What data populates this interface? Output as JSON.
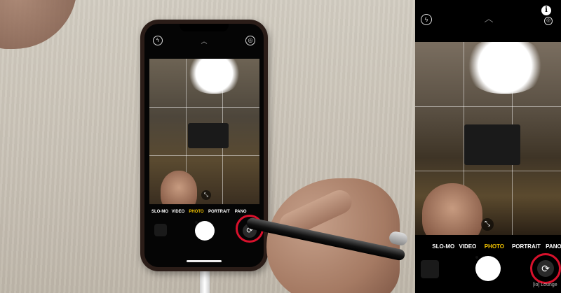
{
  "camera": {
    "modes": [
      "SLO-MO",
      "VIDEO",
      "PHOTO",
      "PORTRAIT",
      "PANO"
    ],
    "active_mode": "PHOTO",
    "accent_color": "#f3c400",
    "highlight_color": "#d8112c",
    "top_icons": {
      "flash": "flash-off-icon",
      "chevron": "chevron-up-icon",
      "live": "live-photo-icon",
      "info": "info-icon"
    },
    "labels": {
      "info": "i",
      "chevron": "︿",
      "flash": "ϟ",
      "live": "◎",
      "zoom": "⤡",
      "flip": "⟳"
    },
    "watermark": "[io] Lounge"
  }
}
